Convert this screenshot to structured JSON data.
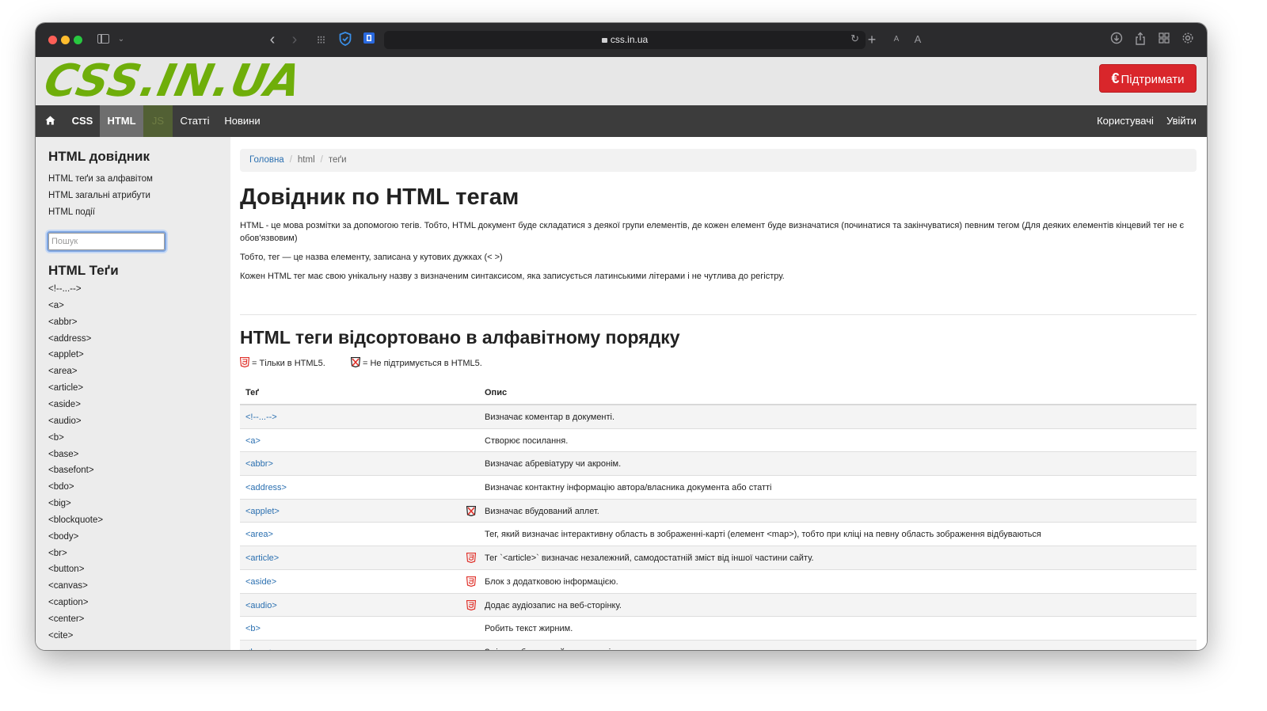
{
  "browser": {
    "url": "css.in.ua",
    "font_small": "A",
    "font_large": "A"
  },
  "header": {
    "logo": "CSS.IN.UA",
    "support_currency": "€",
    "support_label": "Підтримати"
  },
  "nav": {
    "css": "CSS",
    "html": "HTML",
    "js": "JS",
    "articles": "Статті",
    "news": "Новини",
    "users": "Користувачі",
    "login": "Увійти"
  },
  "sidebar": {
    "title": "HTML довідник",
    "links": [
      "HTML теґи за алфавітом",
      "HTML загальні атрибути",
      "HTML події"
    ],
    "search_placeholder": "Пошук",
    "tags_title": "HTML Теґи",
    "tags": [
      "<!--...-->",
      "<a>",
      "<abbr>",
      "<address>",
      "<applet>",
      "<area>",
      "<article>",
      "<aside>",
      "<audio>",
      "<b>",
      "<base>",
      "<basefont>",
      "<bdo>",
      "<big>",
      "<blockquote>",
      "<body>",
      "<br>",
      "<button>",
      "<canvas>",
      "<caption>",
      "<center>",
      "<cite>"
    ]
  },
  "breadcrumb": {
    "home": "Головна",
    "section": "html",
    "current": "теґи"
  },
  "main": {
    "title": "Довідник по HTML тегам",
    "p1": "HTML - це мова розмітки за допомогою тегів. Тобто, HTML документ буде складатися з деякої групи елементів, де кожен елемент буде визначатися (починатися та закінчуватися) певним тегом (Для деяких елементів кінцевий тег не є обов'язвовим)",
    "p2": "Тобто, тег — це назва елементу, записана у кутових дужках (< >)",
    "p3": "Кожен HTML тег має свою унікальну назву з визначеним синтаксисом, яка записується латинськими літерами і не чутлива до регістру.",
    "subtitle": "HTML теги відсортовано в алфавітному порядку",
    "legend_html5": "= Тільки в HTML5.",
    "legend_unsupported": "= Не підтримується в HTML5."
  },
  "table": {
    "col_tag": "Теґ",
    "col_desc": "Опис",
    "rows": [
      {
        "tag": "<!--...-->",
        "desc": "Визначає коментар в документі.",
        "icon": "none"
      },
      {
        "tag": "<a>",
        "desc": "Створює посилання.",
        "icon": "none"
      },
      {
        "tag": "<abbr>",
        "desc": "Визначає абревіатуру чи акронім.",
        "icon": "none"
      },
      {
        "tag": "<address>",
        "desc": "Визначає контактну інформацію автора/власника документа або статті",
        "icon": "none"
      },
      {
        "tag": "<applet>",
        "desc": "Визначає вбудований аплет.",
        "icon": "unsupported"
      },
      {
        "tag": "<area>",
        "desc": "Тег, який визначає інтерактивну область в зображенні-карті (елемент <map>), тобто при кліці на певну область зображення відбуваються",
        "icon": "none"
      },
      {
        "tag": "<article>",
        "desc": "Тег `<article>` визначає незалежний, самодостатній зміст від іншої частини сайту.",
        "icon": "html5"
      },
      {
        "tag": "<aside>",
        "desc": "Блок з додатковою інформацією.",
        "icon": "html5"
      },
      {
        "tag": "<audio>",
        "desc": "Додає аудіозапис на веб-сторінку.",
        "icon": "html5"
      },
      {
        "tag": "<b>",
        "desc": "Робить текст жирним.",
        "icon": "none"
      },
      {
        "tag": "<base>",
        "desc": "Змінює абсолютний шлях сторінки.",
        "icon": "none"
      }
    ]
  }
}
